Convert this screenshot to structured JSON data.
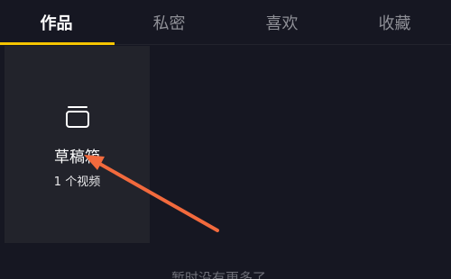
{
  "tabs": [
    {
      "label": "作品",
      "active": true
    },
    {
      "label": "私密",
      "active": false
    },
    {
      "label": "喜欢",
      "active": false
    },
    {
      "label": "收藏",
      "active": false
    }
  ],
  "drafts": {
    "icon": "drafts-box-icon",
    "title": "草稿箱",
    "count_label": "1 个视频"
  },
  "empty_state": "暂时没有更多了",
  "annotation": {
    "icon": "pointer-arrow-icon",
    "color": "#f26a3d"
  },
  "colors": {
    "background": "#161722",
    "accent": "#f6c500",
    "card": "#22232b",
    "tab_inactive": "#8e8f96"
  }
}
